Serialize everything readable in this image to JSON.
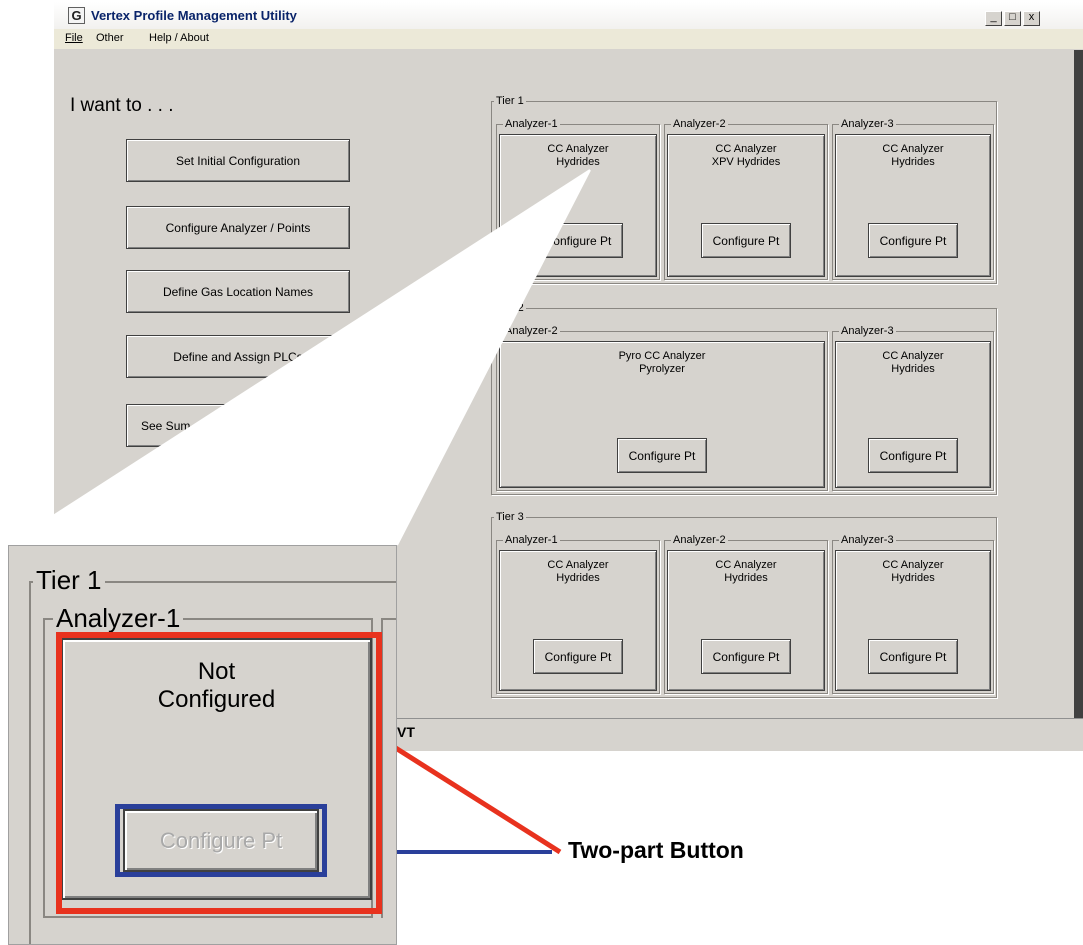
{
  "window": {
    "title": "Vertex Profile Management Utility",
    "icon": "app-logo-icon",
    "controls": [
      "_",
      "□",
      "x"
    ]
  },
  "menu": [
    {
      "label": "File"
    },
    {
      "label": "Other"
    },
    {
      "label": "Help / About"
    }
  ],
  "left_panel": {
    "heading": "I want to . . .",
    "buttons": [
      "Set Initial Configuration",
      "Configure Analyzer / Points",
      "Define Gas Location Names",
      "Define and Assign PLCs",
      "See Sum"
    ]
  },
  "configure_label": "Configure Pt",
  "tiers": [
    {
      "label": "Tier 1",
      "analyzers": [
        {
          "label": "Analyzer-1",
          "line1": "CC Analyzer",
          "line2": "Hydrides"
        },
        {
          "label": "Analyzer-2",
          "line1": "CC Analyzer",
          "line2": "XPV Hydrides"
        },
        {
          "label": "Analyzer-3",
          "line1": "CC Analyzer",
          "line2": "Hydrides"
        }
      ]
    },
    {
      "label": "Tier 2",
      "analyzers": [
        {
          "label": "Analyzer-2",
          "line1": "Pyro CC Analyzer",
          "line2": "Pyrolyzer"
        },
        {
          "label": "Analyzer-3",
          "line1": "CC Analyzer",
          "line2": "Hydrides"
        }
      ]
    },
    {
      "label": "Tier 3",
      "analyzers": [
        {
          "label": "Analyzer-1",
          "line1": "CC Analyzer",
          "line2": "Hydrides"
        },
        {
          "label": "Analyzer-2",
          "line1": "CC Analyzer",
          "line2": "Hydrides"
        },
        {
          "label": "Analyzer-3",
          "line1": "CC Analyzer",
          "line2": "Hydrides"
        }
      ]
    }
  ],
  "status": {
    "text": "VT"
  },
  "zoom": {
    "tier_label": "Tier 1",
    "analyzer_label": "Analyzer-1",
    "status_line1": "Not",
    "status_line2": "Configured",
    "configure_label": "Configure Pt"
  },
  "callout": {
    "label": "Two-part Button"
  },
  "colors": {
    "highlight_outer": "#e8321e",
    "highlight_inner": "#2a3f9a",
    "window_bg": "#d6d3ce"
  }
}
